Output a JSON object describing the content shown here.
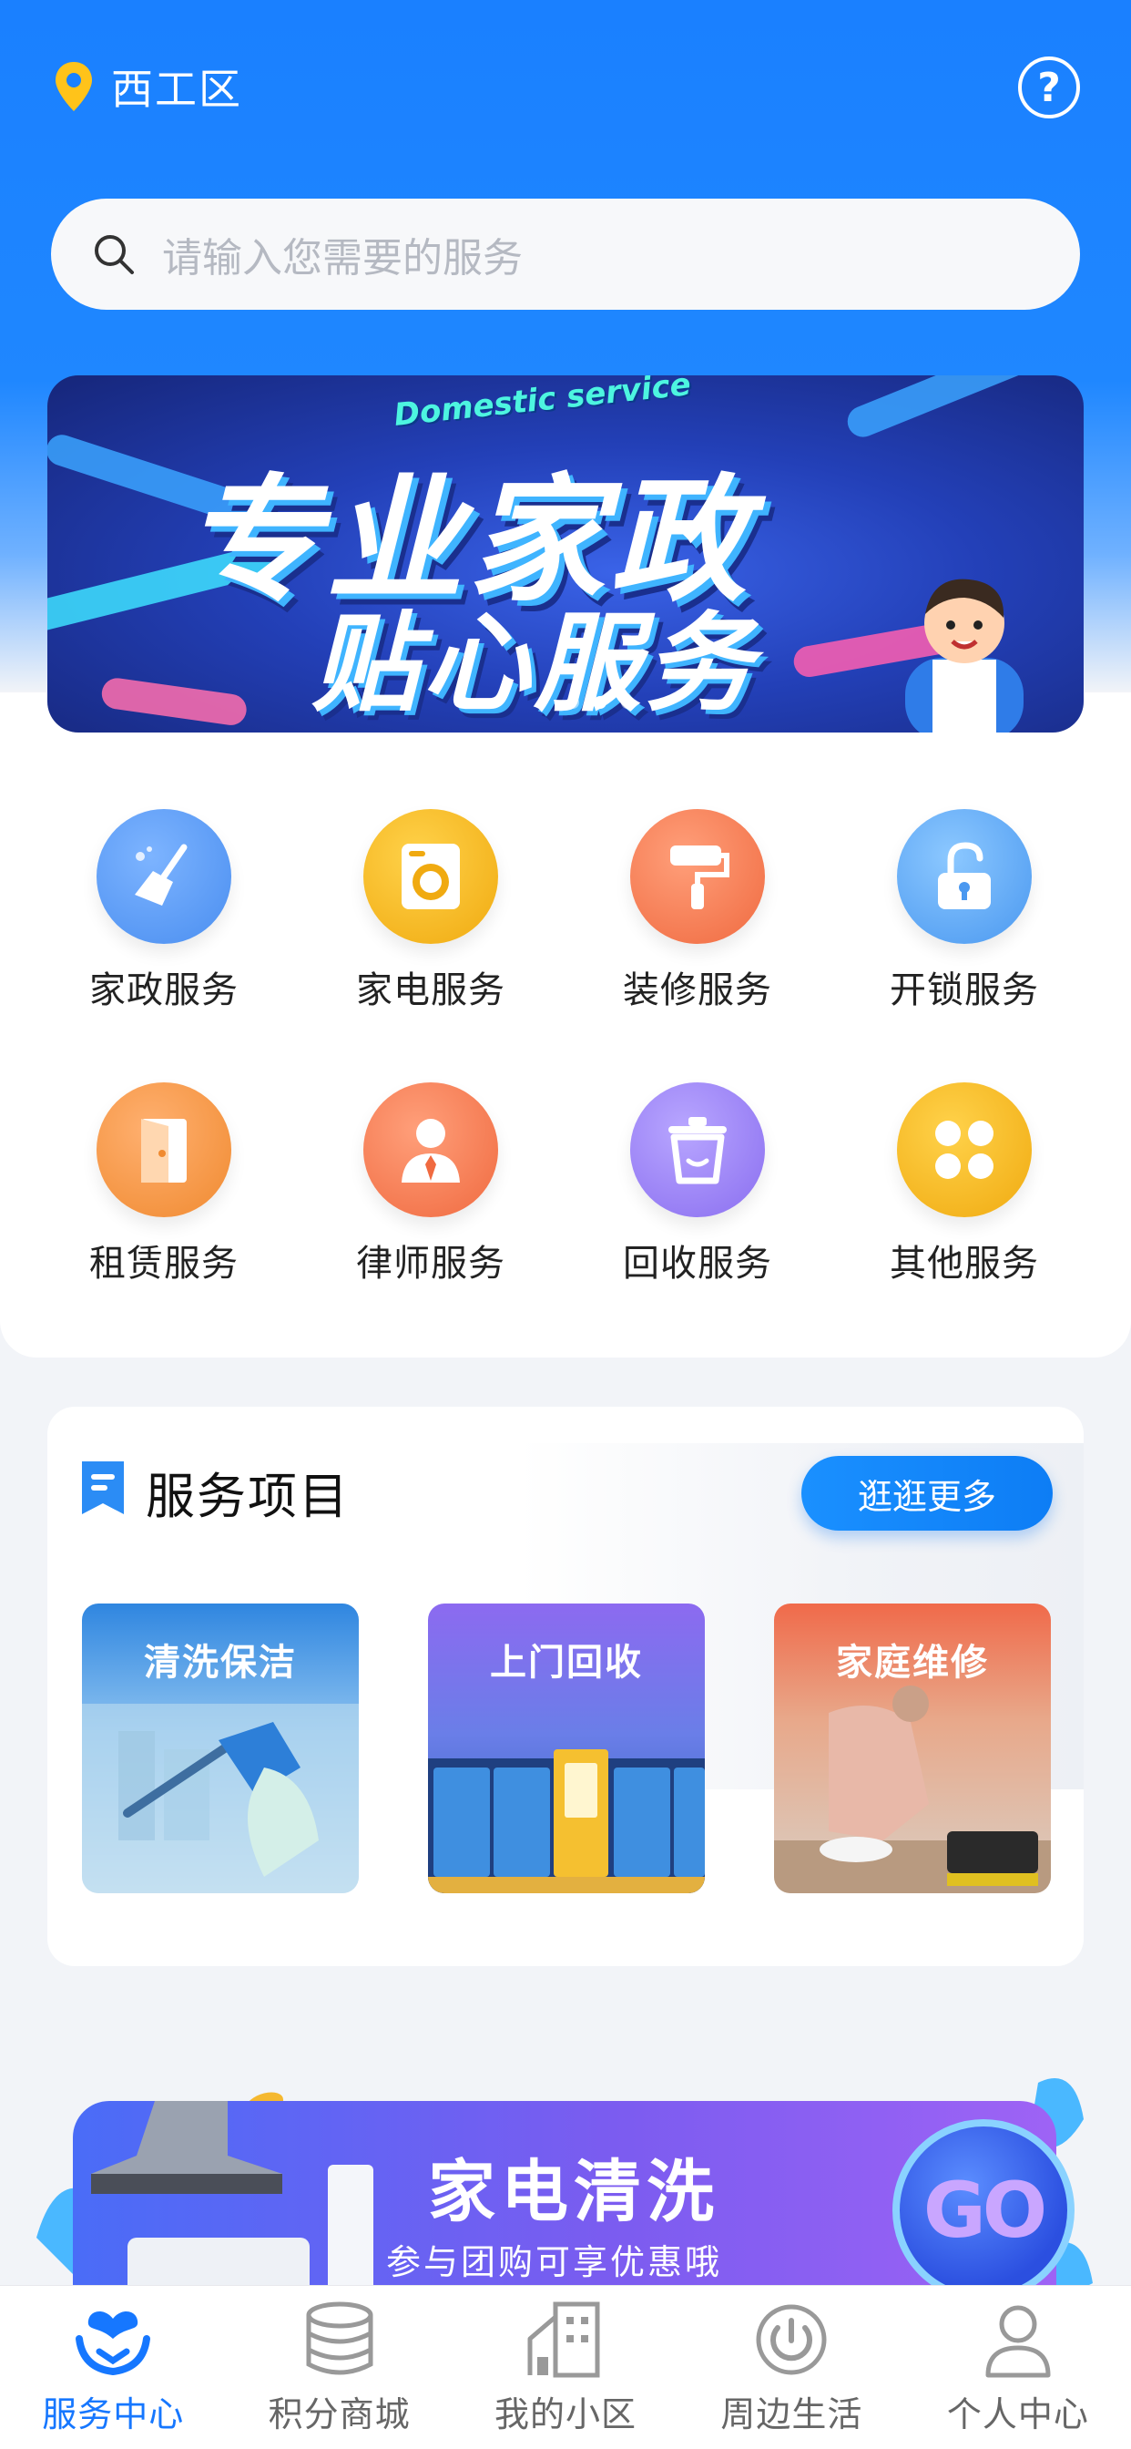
{
  "header": {
    "location": "西工区",
    "help_symbol": "?"
  },
  "search": {
    "placeholder": "请输入您需要的服务"
  },
  "banner": {
    "english_text": "Domestic service",
    "main_text": "专业家政",
    "sub_text": "贴心服务",
    "slides": 3,
    "active_slide": 2
  },
  "services": [
    {
      "label": "家政服务",
      "icon": "broom-icon",
      "color": "#5b9cf5"
    },
    {
      "label": "家电服务",
      "icon": "washing-machine-icon",
      "color": "#f5b92a"
    },
    {
      "label": "装修服务",
      "icon": "paint-roller-icon",
      "color": "#f57a52"
    },
    {
      "label": "开锁服务",
      "icon": "unlock-icon",
      "color": "#5aa6f5"
    },
    {
      "label": "租赁服务",
      "icon": "door-icon",
      "color": "#f59542"
    },
    {
      "label": "律师服务",
      "icon": "lawyer-icon",
      "color": "#f57a52"
    },
    {
      "label": "回收服务",
      "icon": "trash-bin-icon",
      "color": "#9b84f5"
    },
    {
      "label": "其他服务",
      "icon": "four-leaf-icon",
      "color": "#f5b92a"
    }
  ],
  "projects": {
    "title": "服务项目",
    "more_label": "逛逛更多",
    "cards": [
      {
        "label": "清洗保洁",
        "color": "#3f8fe0"
      },
      {
        "label": "上门回收",
        "color": "#8c6af0"
      },
      {
        "label": "家庭维修",
        "color": "#f06a4a"
      }
    ]
  },
  "promo": {
    "title": "家电清洗",
    "subtitle": "参与团购可享优惠哦",
    "go_label": "GO"
  },
  "tabbar": {
    "items": [
      {
        "label": "服务中心",
        "icon": "heart-hands-icon",
        "active": true
      },
      {
        "label": "积分商城",
        "icon": "coins-stack-icon",
        "active": false
      },
      {
        "label": "我的小区",
        "icon": "building-icon",
        "active": false
      },
      {
        "label": "周边生活",
        "icon": "power-circle-icon",
        "active": false
      },
      {
        "label": "个人中心",
        "icon": "person-icon",
        "active": false
      }
    ]
  },
  "colors": {
    "primary": "#1677ff",
    "header_blue": "#1a80ff"
  }
}
